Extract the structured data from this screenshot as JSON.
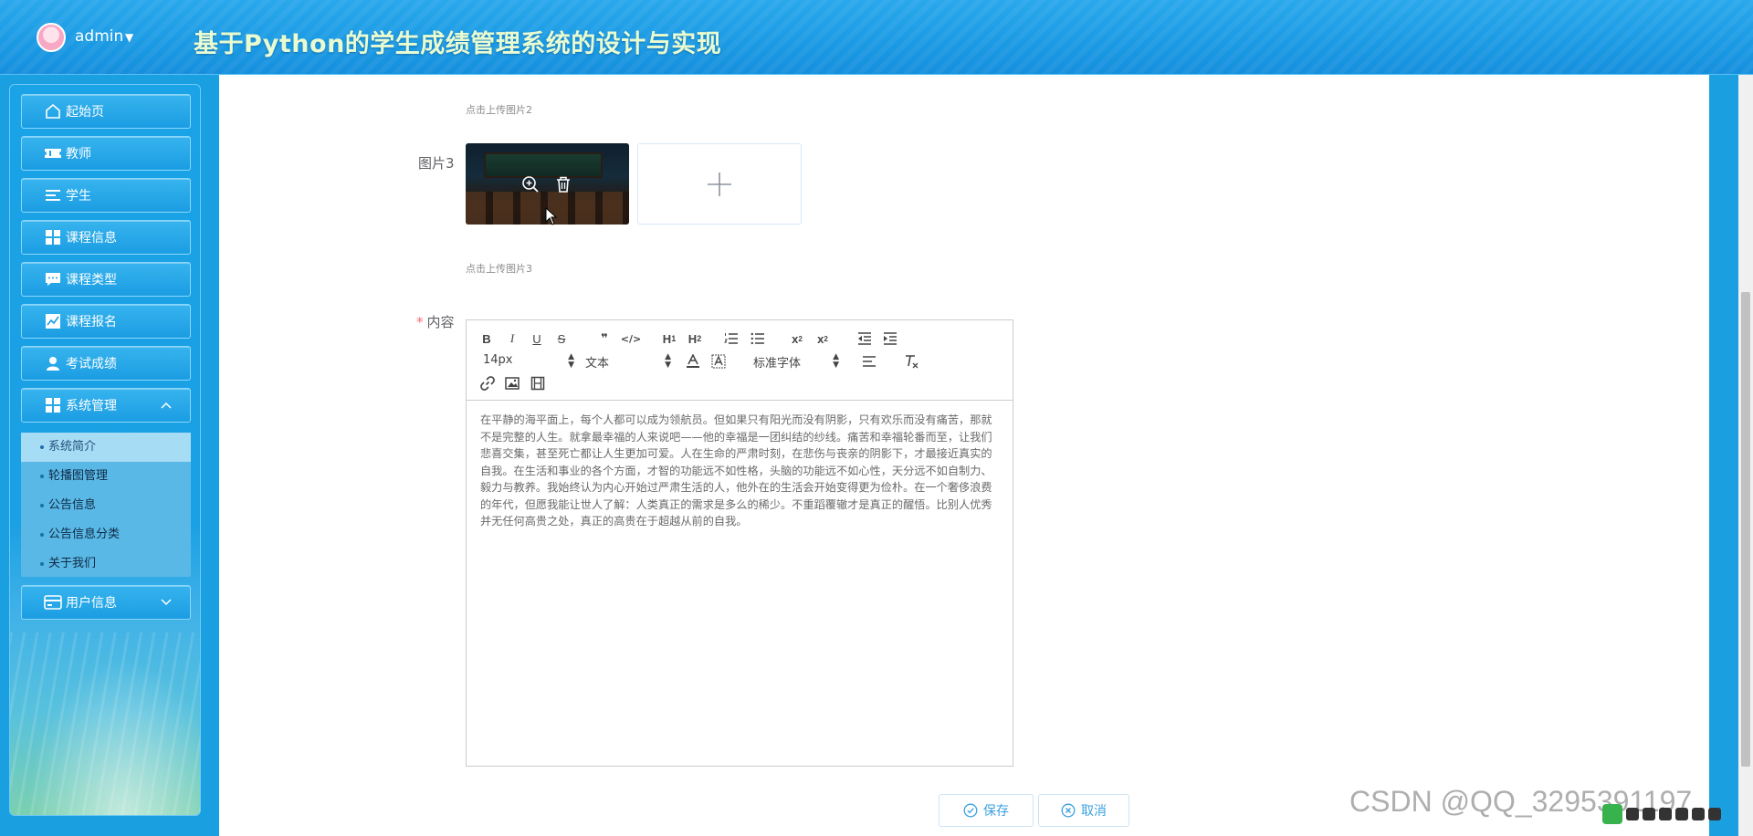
{
  "header": {
    "user": "admin",
    "title": "基于Python的学生成绩管理系统的设计与实现"
  },
  "sidebar": {
    "items": [
      {
        "label": "起始页",
        "icon": "home-icon"
      },
      {
        "label": "教师",
        "icon": "ticket-icon"
      },
      {
        "label": "学生",
        "icon": "list-icon"
      },
      {
        "label": "课程信息",
        "icon": "grid-icon"
      },
      {
        "label": "课程类型",
        "icon": "chat-icon"
      },
      {
        "label": "课程报名",
        "icon": "chart-icon"
      },
      {
        "label": "考试成绩",
        "icon": "user-icon"
      },
      {
        "label": "系统管理",
        "icon": "grid-icon"
      },
      {
        "label": "用户信息",
        "icon": "card-icon"
      }
    ],
    "system_submenu": [
      "系统简介",
      "轮播图管理",
      "公告信息",
      "公告信息分类",
      "关于我们"
    ]
  },
  "form": {
    "tip_image2": "点击上传图片2",
    "image3_label": "图片3",
    "tip_image3": "点击上传图片3",
    "content_label": "内容",
    "required_mark": "*",
    "editor": {
      "font_size": "14px",
      "header_select": "文本",
      "font_family": "标准字体",
      "text": "在平静的海平面上，每个人都可以成为领航员。但如果只有阳光而没有阴影，只有欢乐而没有痛苦，那就不是完整的人生。就拿最幸福的人来说吧——他的幸福是一团纠结的纱线。痛苦和幸福轮番而至，让我们悲喜交集，甚至死亡都让人生更加可爱。人在生命的严肃时刻，在悲伤与丧亲的阴影下，才最接近真实的自我。在生活和事业的各个方面，才智的功能远不如性格，头脑的功能远不如心性，天分远不如自制力、毅力与教养。我始终认为内心开始过严肃生活的人，他外在的生活会开始变得更为俭朴。在一个奢侈浪费的年代，但愿我能让世人了解：人类真正的需求是多么的稀少。不重蹈覆辙才是真正的醒悟。比别人优秀并无任何高贵之处，真正的高贵在于超越从前的自我。"
    },
    "save_label": "保存",
    "cancel_label": "取消"
  },
  "watermark": "CSDN @QQ_3295391197"
}
